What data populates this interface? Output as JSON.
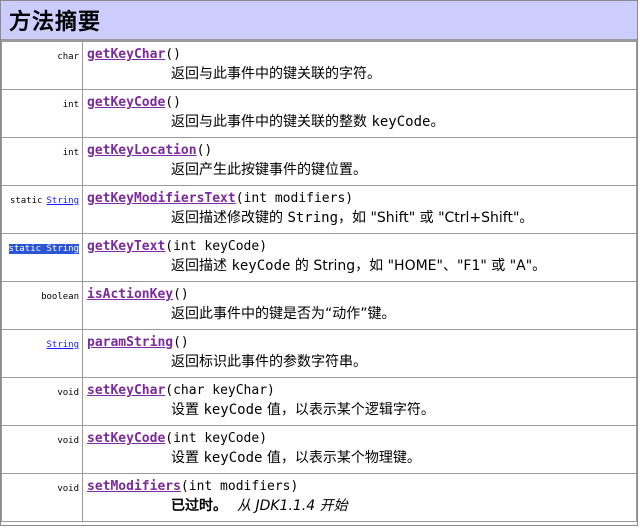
{
  "title": "方法摘要",
  "colors": {
    "header_bg": "#ccccff",
    "method_link": "#7a2a9a",
    "type_link": "#1a1aff",
    "type_highlight": "#2b55d6"
  },
  "rows": [
    {
      "type_prefix": "",
      "type": "char",
      "type_is_link": false,
      "method": "getKeyChar",
      "params": "()",
      "desc": [
        "返回与此事件中的键关联的字符。"
      ]
    },
    {
      "type_prefix": "",
      "type": "int",
      "type_is_link": false,
      "method": "getKeyCode",
      "params": "()",
      "desc": [
        "返回与此事件中的键关联的整数 ",
        "keyCode",
        "。"
      ]
    },
    {
      "type_prefix": "",
      "type": "int",
      "type_is_link": false,
      "method": "getKeyLocation",
      "params": "()",
      "desc": [
        "返回产生此按键事件的键位置。"
      ]
    },
    {
      "type_prefix": "static",
      "type": "String",
      "type_is_link": true,
      "method": "getKeyModifiersText",
      "params": "(int modifiers)",
      "desc": [
        "返回描述修改键的 ",
        "String",
        "，如 \"Shift\" 或 \"Ctrl+Shift\"。"
      ]
    },
    {
      "type_prefix": "static",
      "type": "String",
      "type_is_link": true,
      "highlighted": true,
      "method": "getKeyText",
      "params": "(int keyCode)",
      "desc": [
        "返回描述 ",
        "keyCode",
        " 的 String，如 \"HOME\"、\"F1\" 或 \"A\"。"
      ]
    },
    {
      "type_prefix": "",
      "type": "boolean",
      "type_is_link": false,
      "method": "isActionKey",
      "params": "()",
      "desc": [
        "返回此事件中的键是否为“动作”键。"
      ]
    },
    {
      "type_prefix": "",
      "type": "String",
      "type_is_link": true,
      "method": "paramString",
      "params": "()",
      "desc": [
        "返回标识此事件的参数字符串。"
      ]
    },
    {
      "type_prefix": "",
      "type": "void",
      "type_is_link": false,
      "method": "setKeyChar",
      "params": "(char keyChar)",
      "desc": [
        "设置 ",
        "keyCode",
        " 值，以表示某个逻辑字符。"
      ]
    },
    {
      "type_prefix": "",
      "type": "void",
      "type_is_link": false,
      "method": "setKeyCode",
      "params": "(int keyCode)",
      "desc": [
        "设置 ",
        "keyCode",
        " 值，以表示某个物理键。"
      ]
    },
    {
      "type_prefix": "",
      "type": "void",
      "type_is_link": false,
      "method": "setModifiers",
      "params": "(int modifiers)",
      "deprecated": "已过时。",
      "deprecated_note": "从 JDK1.1.4 开始",
      "desc": []
    }
  ]
}
